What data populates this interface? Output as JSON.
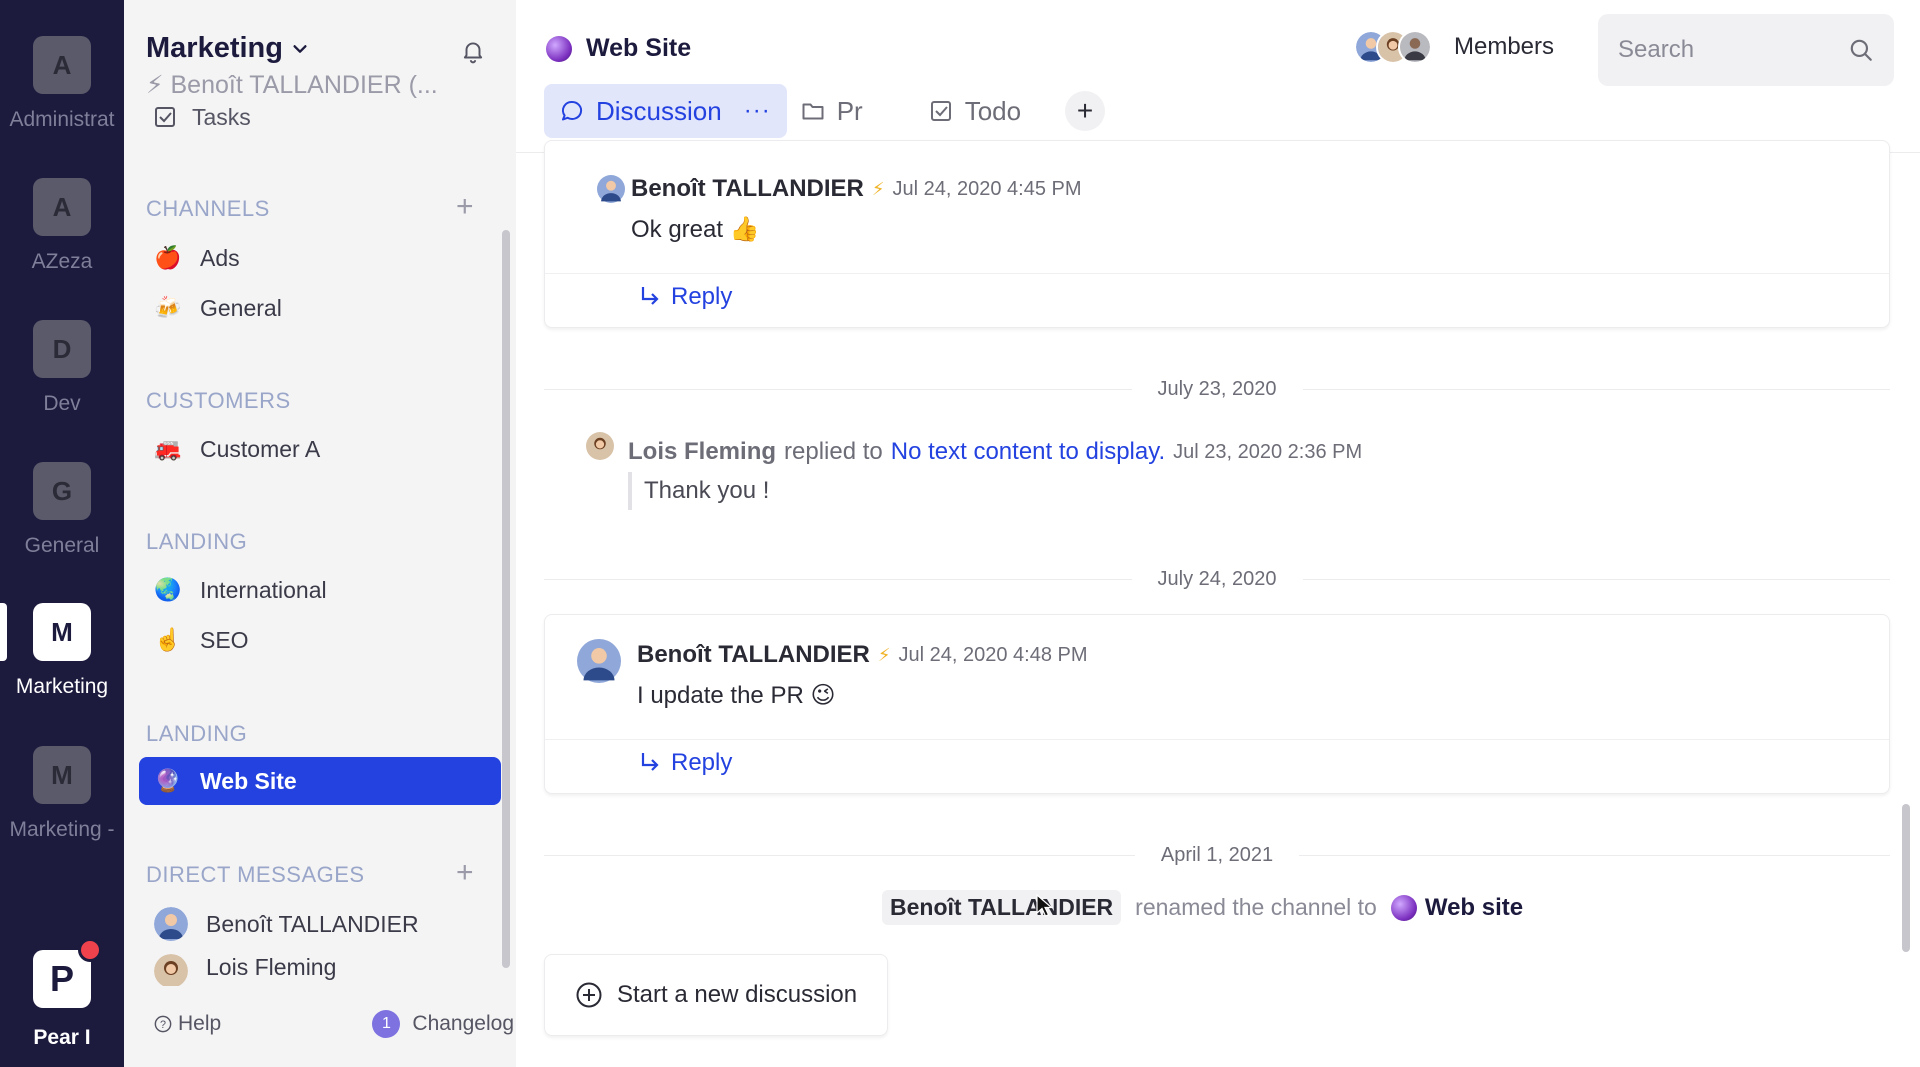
{
  "rail": {
    "workspaces": [
      {
        "initial": "A",
        "label": "Administrat"
      },
      {
        "initial": "A",
        "label": "AZeza"
      },
      {
        "initial": "D",
        "label": "Dev"
      },
      {
        "initial": "G",
        "label": "General"
      },
      {
        "initial": "M",
        "label": "Marketing",
        "active": true
      },
      {
        "initial": "M",
        "label": "Marketing -"
      }
    ],
    "pear": {
      "initial": "P",
      "label": "Pear I"
    }
  },
  "sidebar": {
    "workspace_name": "Marketing",
    "user_status": "⚡ Benoît TALLANDIER (...",
    "tasks_label": "Tasks",
    "sections": {
      "channels": "CHANNELS",
      "customers": "CUSTOMERS",
      "landing1": "LANDING",
      "landing2": "LANDING",
      "direct_messages": "DIRECT MESSAGES"
    },
    "channels": [
      {
        "emoji": "🍎",
        "name": "Ads"
      },
      {
        "emoji": "🍻",
        "name": "General"
      }
    ],
    "customers": [
      {
        "emoji": "🚒",
        "name": "Customer A"
      }
    ],
    "landing": [
      {
        "emoji": "🌏",
        "name": "International"
      },
      {
        "emoji": "☝️",
        "name": "SEO"
      }
    ],
    "landing2": [
      {
        "emoji": "🔮",
        "name": "Web Site"
      }
    ],
    "dms": [
      {
        "name": "Benoît TALLANDIER"
      },
      {
        "name": "Lois Fleming"
      }
    ],
    "help_label": "Help",
    "changelog_label": "Changelog",
    "changelog_count": "1"
  },
  "header": {
    "channel_name": "Web Site",
    "members_label": "Members",
    "search_placeholder": "Search",
    "tabs": [
      {
        "label": "Discussion",
        "more": "···"
      },
      {
        "label": "Pr"
      },
      {
        "label": "Todo"
      }
    ],
    "add_tab": "+"
  },
  "messages": {
    "m1": {
      "author": "Benoît TALLANDIER",
      "time": "Jul 24, 2020 4:45 PM",
      "text": "Ok great 👍",
      "reply": "Reply"
    },
    "date1": "July 23, 2020",
    "m2": {
      "author": "Lois Fleming",
      "replied_to": "replied to",
      "link": "No text content to display.",
      "time": "Jul 23, 2020 2:36 PM",
      "quote": "Thank you !"
    },
    "date2": "July 24, 2020",
    "m3": {
      "author": "Benoît TALLANDIER",
      "time": "Jul 24, 2020 4:48 PM",
      "text": "I update the PR 😉",
      "reply": "Reply"
    },
    "date3": "April 1, 2021",
    "rename": {
      "author": "Benoît TALLANDIER",
      "text": "renamed the channel to",
      "new_name": "Web site"
    }
  },
  "new_discussion_label": "Start a new discussion",
  "colors": {
    "accent": "#2342e0",
    "rail": "#1c1a3d",
    "sidebar": "#f4f4f5"
  }
}
